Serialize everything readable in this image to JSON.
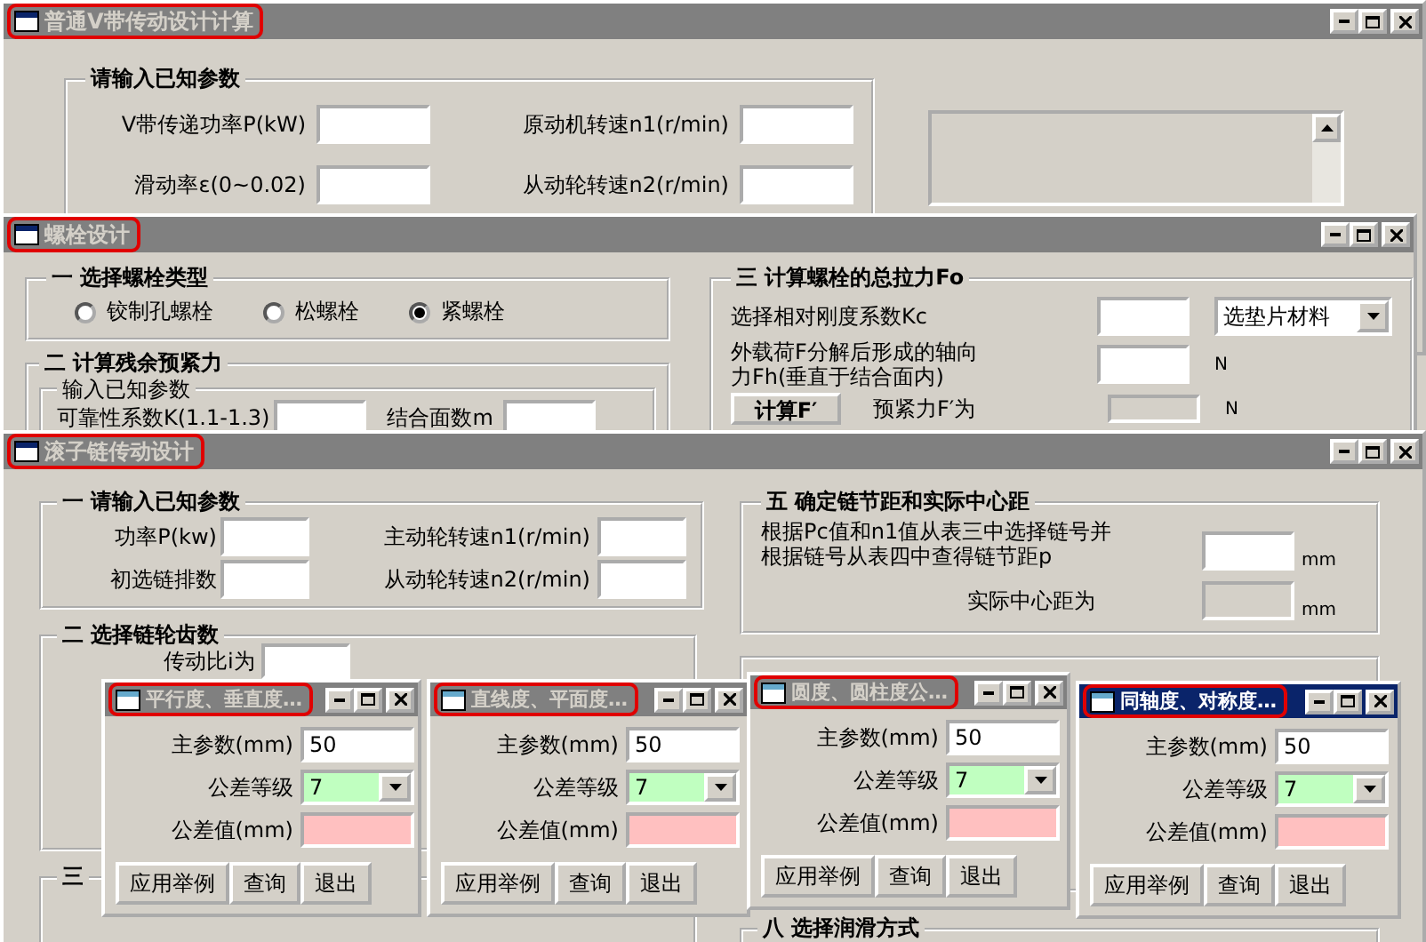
{
  "vbelt_window": {
    "title": "普通V带传动设计计算",
    "active": false,
    "params_group": {
      "title": "请输入已知参数",
      "fields": [
        {
          "label": "V带传递功率P(kW)"
        },
        {
          "label": "原动机转速n1(r/min)"
        },
        {
          "label": "滑动率ε(0~0.02)"
        },
        {
          "label": "从动轮转速n2(r/min)"
        }
      ]
    }
  },
  "bolt_window": {
    "title": "螺栓设计",
    "active": false,
    "type_group": {
      "title": "一 选择螺栓类型",
      "options": [
        {
          "label": "铰制孔螺栓",
          "selected": false
        },
        {
          "label": "松螺栓",
          "selected": false
        },
        {
          "label": "紧螺栓",
          "selected": true
        }
      ]
    },
    "preload_group": {
      "title": "二 计算残余预紧力",
      "subgroup_title": "输入已知参数",
      "fields": [
        {
          "label": "可靠性系数K(1.1-1.3)"
        },
        {
          "label": "结合面数m"
        }
      ]
    },
    "force_group": {
      "title": "三 计算螺栓的总拉力Fo",
      "stiffness_label": "选择相对刚度系数Kc",
      "material_select": "选垫片材料",
      "axial_label_lines": [
        "外载荷F分解后形成的轴向",
        "力Fh(垂直于结合面内)"
      ],
      "axial_unit": "N",
      "calc_button": "计算F′",
      "preload_label": "预紧力F′为",
      "preload_unit": "N"
    }
  },
  "chain_window": {
    "title": "滚子链传动设计",
    "active": false,
    "params_group": {
      "title": "一 请输入已知参数",
      "fields": [
        {
          "label": "功率P(kw)"
        },
        {
          "label": "主动轮转速n1(r/min)"
        },
        {
          "label": "初选链排数"
        },
        {
          "label": "从动轮转速n2(r/min)"
        }
      ]
    },
    "teeth_group": {
      "title": "二 选择链轮齿数",
      "ratio_label": "传动比i为"
    },
    "group_3": {
      "title": "三"
    },
    "pitch_group": {
      "title": "五 确定链节距和实际中心距",
      "instruction_lines": [
        "根据Pc值和n1值从表三中选择链号并",
        "根据链号从表四中查得链节距p"
      ],
      "pitch_unit": "mm",
      "center_label": "实际中心距为",
      "center_unit": "mm"
    },
    "lube_group": {
      "title": "八 选择润滑方式"
    }
  },
  "tolerance_windows": [
    {
      "title": "平行度、垂直度…",
      "active": false,
      "main_param_label": "主参数(mm)",
      "main_param_value": "50",
      "grade_label": "公差等级",
      "grade_value": "7",
      "tolerance_label": "公差值(mm)",
      "buttons": [
        "应用举例",
        "查询",
        "退出"
      ]
    },
    {
      "title": "直线度、平面度…",
      "active": false,
      "main_param_label": "主参数(mm)",
      "main_param_value": "50",
      "grade_label": "公差等级",
      "grade_value": "7",
      "tolerance_label": "公差值(mm)",
      "buttons": [
        "应用举例",
        "查询",
        "退出"
      ]
    },
    {
      "title": "圆度、圆柱度公…",
      "active": false,
      "main_param_label": "主参数(mm)",
      "main_param_value": "50",
      "grade_label": "公差等级",
      "grade_value": "7",
      "tolerance_label": "公差值(mm)",
      "buttons": [
        "应用举例",
        "查询",
        "退出"
      ]
    },
    {
      "title": "同轴度、对称度…",
      "active": true,
      "main_param_label": "主参数(mm)",
      "main_param_value": "50",
      "grade_label": "公差等级",
      "grade_value": "7",
      "tolerance_label": "公差值(mm)",
      "buttons": [
        "应用举例",
        "查询",
        "退出"
      ]
    }
  ]
}
